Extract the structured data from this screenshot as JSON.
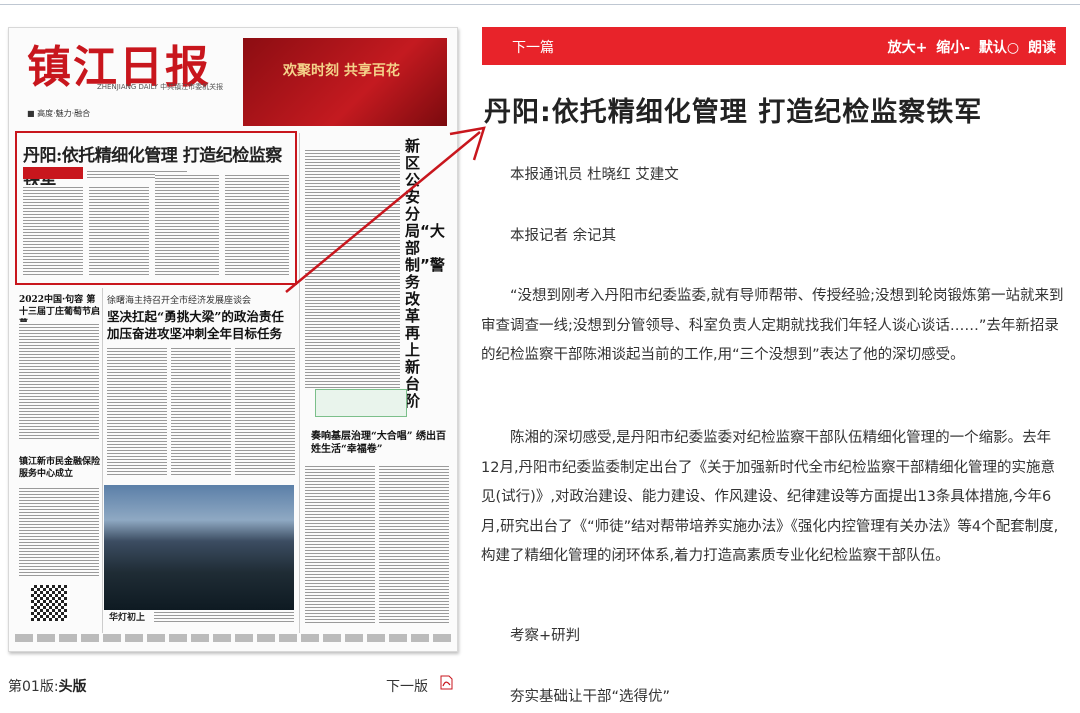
{
  "paper": {
    "masthead": "镇江日报",
    "masthead_sub": "ZHENJIANG DAILY 中共镇江市委机关报",
    "motto": "■ 高度·魅力·融合",
    "ad_text": "欢聚时刻 共享百花",
    "headline": "丹阳:依托精细化管理 打造纪检监察铁军",
    "vertical_headline": "新区公安分局“大部制”警务改革再上新台阶",
    "section_head_1": "坚决扛起“勇挑大梁”的政治责任 加压奋进攻坚冲刺全年目标任务",
    "section_head_2": "奏响基层治理“大合唱” 绣出百姓生活“幸福卷”",
    "section_head_3": "2022中国·句容 第十三届丁庄葡萄节启幕",
    "section_head_4": "镇江新市民金融保险服务中心成立",
    "photo_caption": "华灯初上"
  },
  "edition": {
    "label": "第01版:",
    "name": "头版"
  },
  "next_link": "下一版",
  "toolbar": {
    "next": "下一篇",
    "zoom_in": "放大+",
    "zoom_out": "缩小-",
    "default": "默认○",
    "read_aloud": "朗读"
  },
  "article": {
    "title": "丹阳:依托精细化管理 打造纪检监察铁军",
    "byline_1": "本报通讯员 杜晓红 艾建文",
    "byline_2": "本报记者 余记其",
    "para_1": "“没想到刚考入丹阳市纪委监委,就有导师帮带、传授经验;没想到轮岗锻炼第一站就来到审查调查一线;没想到分管领导、科室负责人定期就找我们年轻人谈心谈话……”去年新招录的纪检监察干部陈湘谈起当前的工作,用“三个没想到”表达了他的深切感受。",
    "para_2": "陈湘的深切感受,是丹阳市纪委监委对纪检监察干部队伍精细化管理的一个缩影。去年12月,丹阳市纪委监委制定出台了《关于加强新时代全市纪检监察干部精细化管理的实施意见(试行)》,对政治建设、能力建设、作风建设、纪律建设等方面提出13条具体措施,今年6月,研究出台了《“师徒”结对帮带培养实施办法》《强化内控管理有关办法》等4个配套制度,构建了精细化管理的闭环体系,着力打造高素质专业化纪检监察干部队伍。",
    "subhead_1": "考察+研判",
    "subhead_2": "夯实基础让干部“选得优”"
  },
  "colors": {
    "accent": "#e8232a",
    "masthead_red": "#c8161d"
  }
}
